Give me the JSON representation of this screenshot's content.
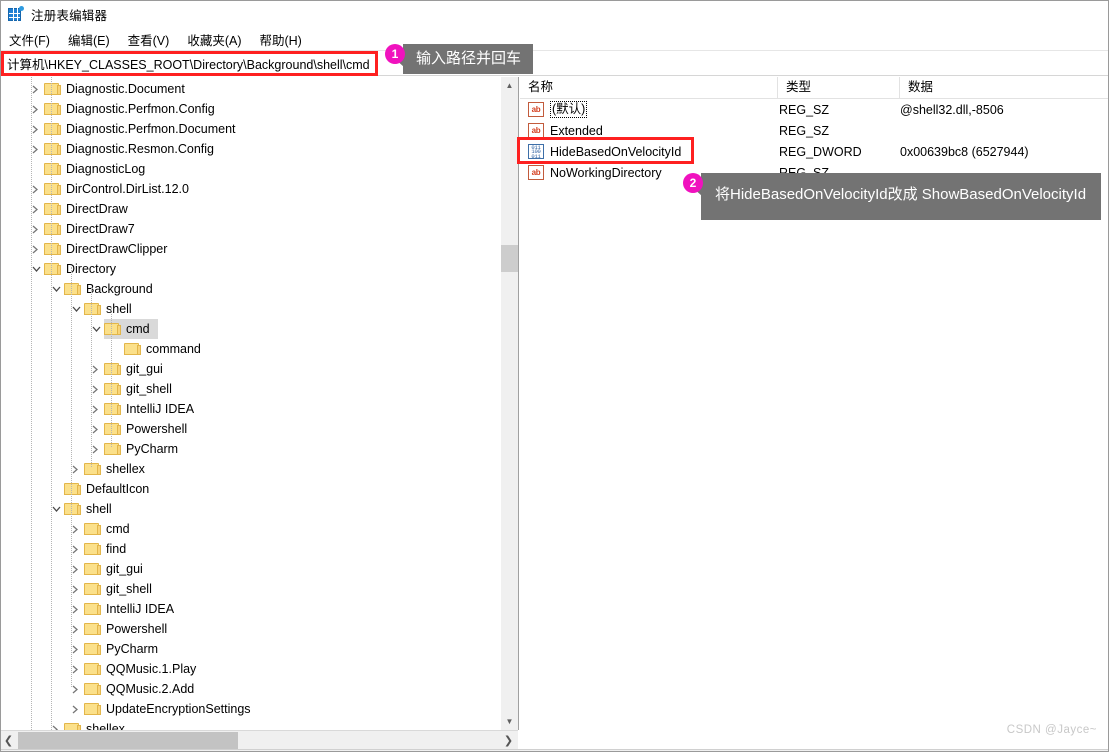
{
  "window": {
    "title": "注册表编辑器",
    "icon": "registry-editor-icon"
  },
  "menubar": {
    "items": [
      {
        "label": "文件(F)"
      },
      {
        "label": "编辑(E)"
      },
      {
        "label": "查看(V)"
      },
      {
        "label": "收藏夹(A)"
      },
      {
        "label": "帮助(H)"
      }
    ]
  },
  "address": {
    "value": "计算机\\HKEY_CLASSES_ROOT\\Directory\\Background\\shell\\cmd",
    "placeholder": ""
  },
  "tree": {
    "items": [
      {
        "label": "Diagnostic.Document",
        "indent": 1,
        "twisty": "collapsed"
      },
      {
        "label": "Diagnostic.Perfmon.Config",
        "indent": 1,
        "twisty": "collapsed"
      },
      {
        "label": "Diagnostic.Perfmon.Document",
        "indent": 1,
        "twisty": "collapsed"
      },
      {
        "label": "Diagnostic.Resmon.Config",
        "indent": 1,
        "twisty": "collapsed"
      },
      {
        "label": "DiagnosticLog",
        "indent": 1,
        "twisty": "none"
      },
      {
        "label": "DirControl.DirList.12.0",
        "indent": 1,
        "twisty": "collapsed"
      },
      {
        "label": "DirectDraw",
        "indent": 1,
        "twisty": "collapsed"
      },
      {
        "label": "DirectDraw7",
        "indent": 1,
        "twisty": "collapsed"
      },
      {
        "label": "DirectDrawClipper",
        "indent": 1,
        "twisty": "collapsed"
      },
      {
        "label": "Directory",
        "indent": 1,
        "twisty": "expanded"
      },
      {
        "label": "Background",
        "indent": 2,
        "twisty": "expanded"
      },
      {
        "label": "shell",
        "indent": 3,
        "twisty": "expanded"
      },
      {
        "label": "cmd",
        "indent": 4,
        "twisty": "expanded",
        "selected": true
      },
      {
        "label": "command",
        "indent": 5,
        "twisty": "none"
      },
      {
        "label": "git_gui",
        "indent": 4,
        "twisty": "collapsed"
      },
      {
        "label": "git_shell",
        "indent": 4,
        "twisty": "collapsed"
      },
      {
        "label": "IntelliJ IDEA",
        "indent": 4,
        "twisty": "collapsed"
      },
      {
        "label": "Powershell",
        "indent": 4,
        "twisty": "collapsed"
      },
      {
        "label": "PyCharm",
        "indent": 4,
        "twisty": "collapsed"
      },
      {
        "label": "shellex",
        "indent": 3,
        "twisty": "collapsed"
      },
      {
        "label": "DefaultIcon",
        "indent": 2,
        "twisty": "none"
      },
      {
        "label": "shell",
        "indent": 2,
        "twisty": "expanded"
      },
      {
        "label": "cmd",
        "indent": 3,
        "twisty": "collapsed"
      },
      {
        "label": "find",
        "indent": 3,
        "twisty": "collapsed"
      },
      {
        "label": "git_gui",
        "indent": 3,
        "twisty": "collapsed"
      },
      {
        "label": "git_shell",
        "indent": 3,
        "twisty": "collapsed"
      },
      {
        "label": "IntelliJ IDEA",
        "indent": 3,
        "twisty": "collapsed"
      },
      {
        "label": "Powershell",
        "indent": 3,
        "twisty": "collapsed"
      },
      {
        "label": "PyCharm",
        "indent": 3,
        "twisty": "collapsed"
      },
      {
        "label": "QQMusic.1.Play",
        "indent": 3,
        "twisty": "collapsed"
      },
      {
        "label": "QQMusic.2.Add",
        "indent": 3,
        "twisty": "collapsed"
      },
      {
        "label": "UpdateEncryptionSettings",
        "indent": 3,
        "twisty": "collapsed"
      },
      {
        "label": "shellex",
        "indent": 2,
        "twisty": "collapsed"
      }
    ]
  },
  "values": {
    "headers": {
      "name": "名称",
      "type": "类型",
      "data": "数据"
    },
    "rows": [
      {
        "name": "(默认)",
        "type": "REG_SZ",
        "data": "@shell32.dll,-8506",
        "icon": "string-value-icon",
        "focused": true
      },
      {
        "name": "Extended",
        "type": "REG_SZ",
        "data": "",
        "icon": "string-value-icon",
        "focused": false
      },
      {
        "name": "HideBasedOnVelocityId",
        "type": "REG_DWORD",
        "data": "0x00639bc8 (6527944)",
        "icon": "dword-value-icon",
        "focused": false,
        "highlighted": true
      },
      {
        "name": "NoWorkingDirectory",
        "type": "REG_SZ",
        "data": "",
        "icon": "string-value-icon",
        "focused": false
      }
    ]
  },
  "callouts": [
    {
      "badge": "1",
      "text": "输入路径并回车"
    },
    {
      "badge": "2",
      "text": "将HideBasedOnVelocityId改成 ShowBasedOnVelocityId"
    }
  ],
  "watermark": {
    "text": "CSDN @Jayce~"
  },
  "colors": {
    "annotation_red": "#fe2020",
    "badge_magenta": "#f012be",
    "bubble_gray": "#737373",
    "folder_yellow": "#fbe08a",
    "selection_gray": "#d9d9d9"
  }
}
